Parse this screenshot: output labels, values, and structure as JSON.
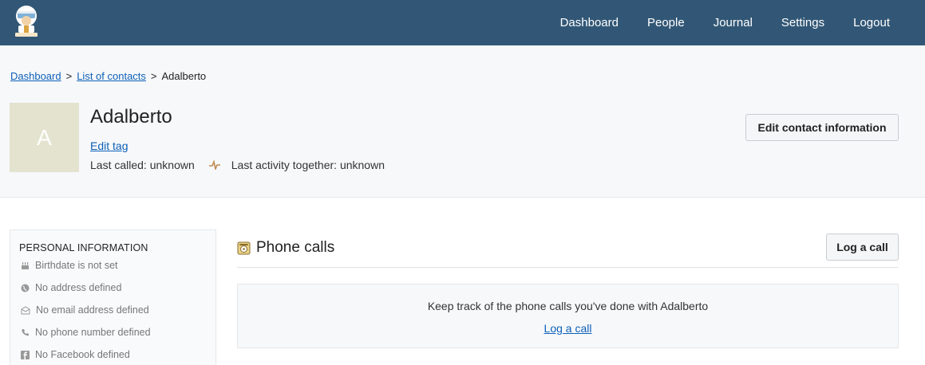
{
  "nav": {
    "items": [
      {
        "label": "Dashboard"
      },
      {
        "label": "People"
      },
      {
        "label": "Journal"
      },
      {
        "label": "Settings"
      },
      {
        "label": "Logout"
      }
    ]
  },
  "breadcrumb": {
    "dashboard": "Dashboard",
    "sep1": ">",
    "contacts": "List of contacts",
    "sep2": ">",
    "current": "Adalberto"
  },
  "contact": {
    "initial": "A",
    "name": "Adalberto",
    "edit_tag": "Edit tag",
    "last_called": "Last called: unknown",
    "last_activity": "Last activity together: unknown",
    "edit_button": "Edit contact information",
    "avatar_color": "#e3e3cf"
  },
  "sidebar": {
    "title": "PERSONAL INFORMATION",
    "items": [
      {
        "icon": "cake-icon",
        "label": "Birthdate is not set"
      },
      {
        "icon": "globe-icon",
        "label": "No address defined"
      },
      {
        "icon": "envelope-icon",
        "label": "No email address defined"
      },
      {
        "icon": "phone-icon",
        "label": "No phone number defined"
      },
      {
        "icon": "facebook-icon",
        "label": "No Facebook defined"
      }
    ]
  },
  "phone_calls": {
    "title": "Phone calls",
    "log_button": "Log a call",
    "empty_text": "Keep track of the phone calls you've done with Adalberto",
    "empty_link": "Log a call"
  },
  "colors": {
    "header": "#325776",
    "link": "#0d60b8"
  }
}
